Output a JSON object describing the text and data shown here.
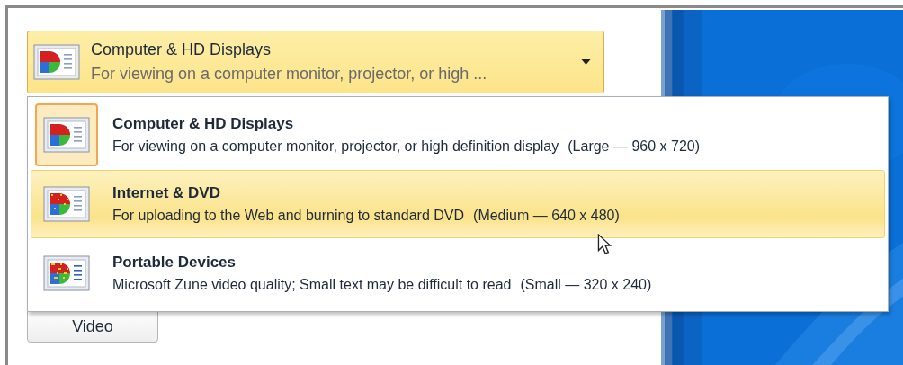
{
  "dropdown": {
    "title": "Computer & HD Displays",
    "description": "For viewing on a computer monitor, projector, or high ...",
    "expanded": true
  },
  "options": [
    {
      "title": "Computer & HD Displays",
      "description": "For viewing on a computer monitor, projector, or high definition display",
      "size": "(Large — 960 x 720)",
      "checked": true,
      "highlighted": false
    },
    {
      "title": "Internet & DVD",
      "description": "For uploading to the Web and burning to standard DVD",
      "size": "(Medium — 640 x 480)",
      "checked": false,
      "highlighted": true
    },
    {
      "title": "Portable Devices",
      "description": "Microsoft Zune video quality; Small text may be difficult to read",
      "size": "(Small — 320 x 240)",
      "checked": false,
      "highlighted": false
    }
  ],
  "video_button": {
    "label": "Video"
  }
}
